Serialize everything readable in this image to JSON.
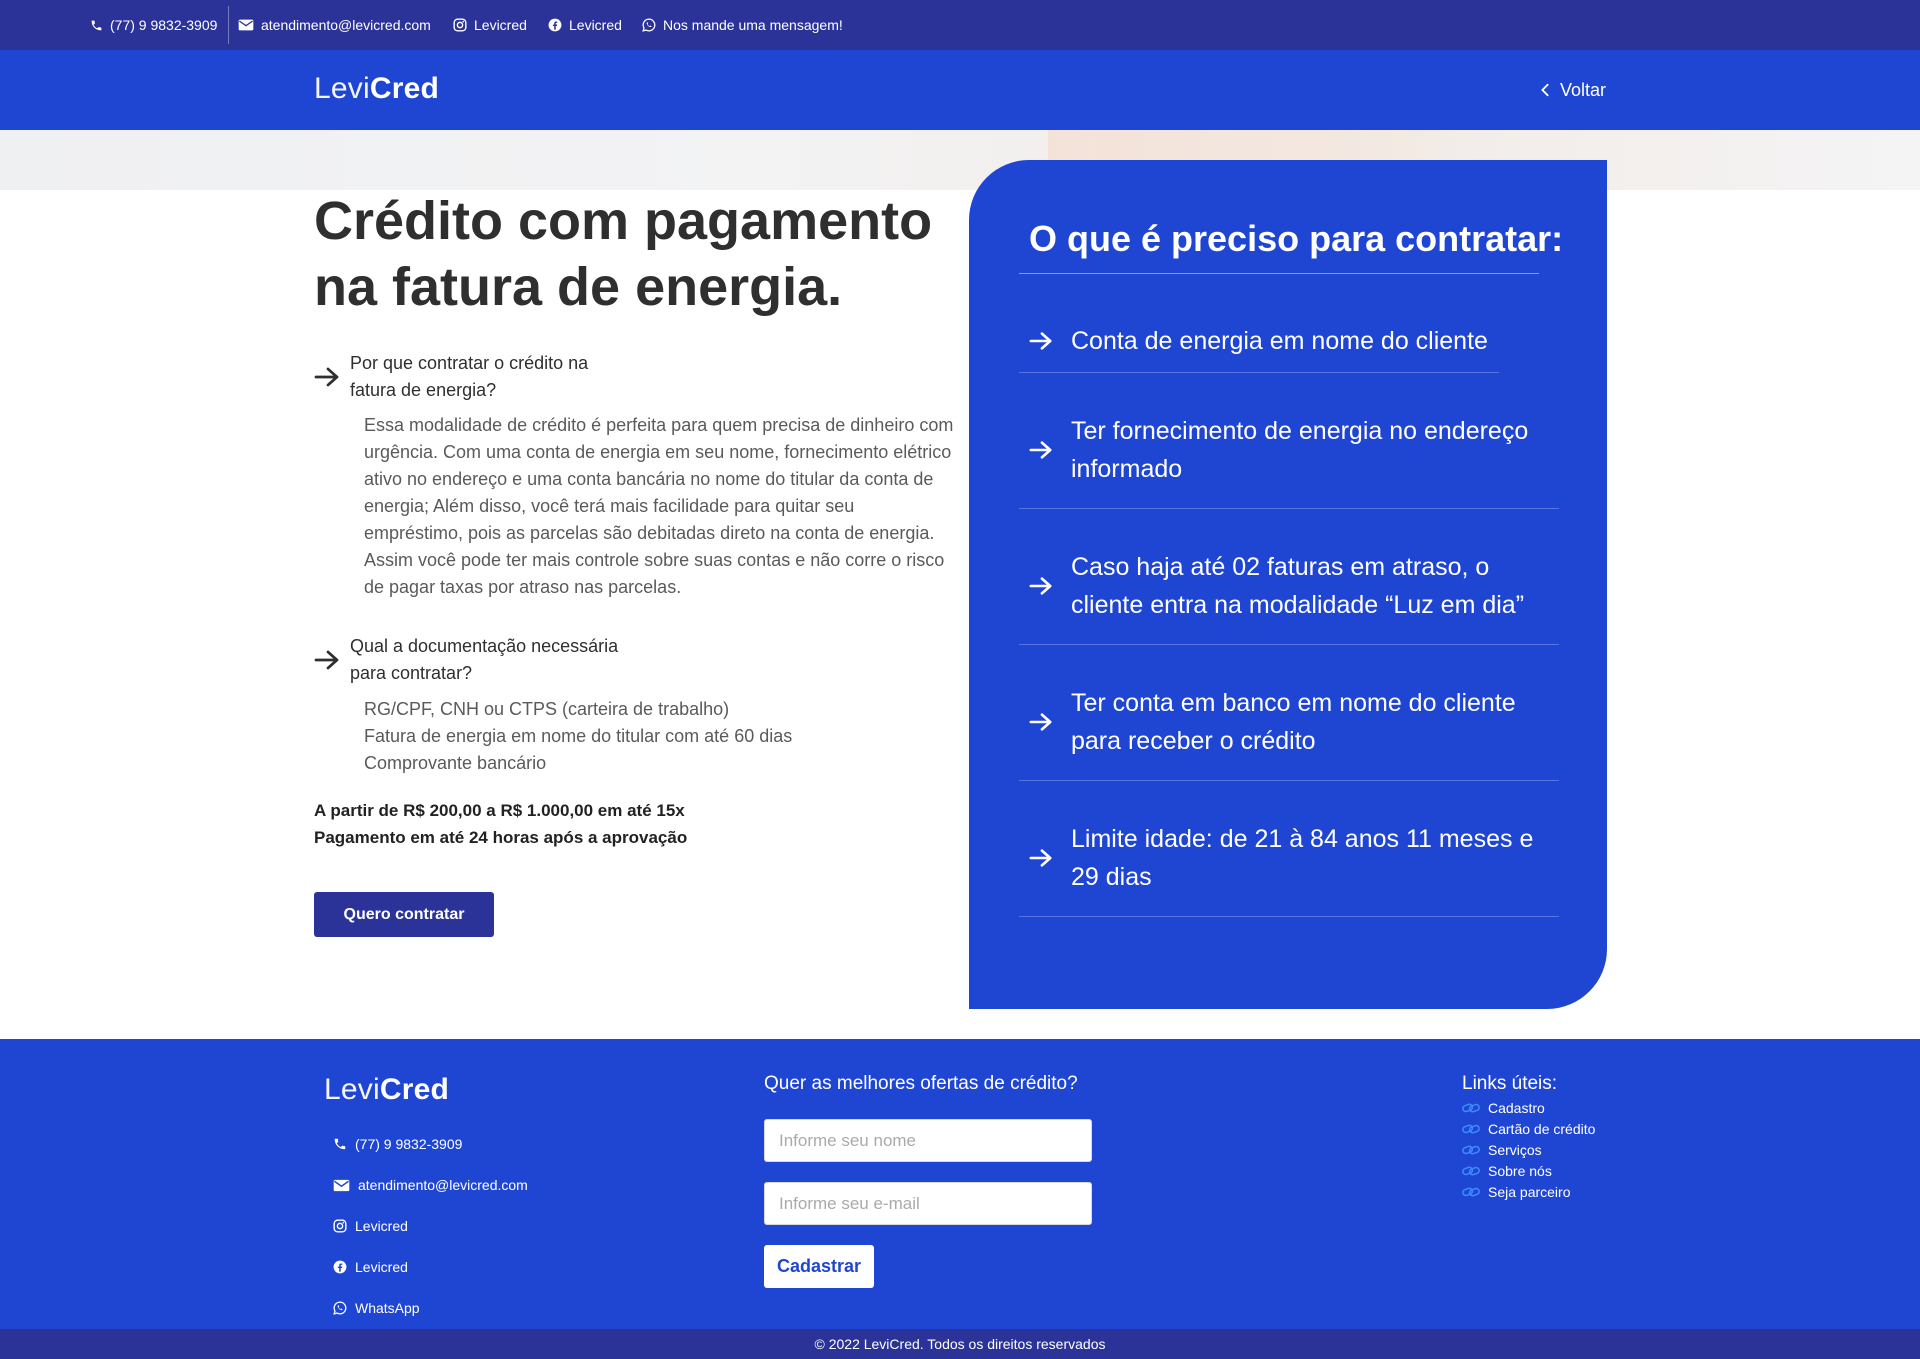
{
  "topbar": {
    "phone": "(77) 9 9832-3909",
    "email": "atendimento@levicred.com",
    "instagram": "Levicred",
    "facebook": "Levicred",
    "whatsapp": "Nos mande uma mensagem!"
  },
  "brand": {
    "part1": "Levi",
    "part2": "Cred"
  },
  "nav": {
    "back_label": "Voltar"
  },
  "hero": {
    "title": "Crédito com pagamento na fatura de energia.",
    "q1": "Por que contratar o crédito na fatura de energia?",
    "a1": "Essa modalidade de crédito é perfeita para quem precisa de dinheiro com urgência. Com uma conta de energia em seu nome, fornecimento elétrico ativo no endereço e uma conta bancária no nome do titular da conta de energia; Além disso, você terá mais facilidade para quitar seu empréstimo, pois as parcelas são debitadas direto na conta de energia. Assim você pode ter mais controle sobre suas contas e não corre o risco de pagar taxas por atraso nas parcelas.",
    "q2": "Qual a documentação necessária para contratar?",
    "docs": [
      "RG/CPF, CNH ou CTPS (carteira de trabalho)",
      "Fatura de energia em nome do titular com até 60 dias",
      "Comprovante bancário"
    ],
    "range": "A partir de R$ 200,00 a R$ 1.000,00 em até 15x",
    "payment": "Pagamento em até 24 horas após a aprovação",
    "cta": "Quero contratar"
  },
  "requirements": {
    "title": "O que é preciso para contratar:",
    "items": [
      "Conta de energia em nome do cliente",
      "Ter fornecimento de energia no endereço informado",
      "Caso haja até 02 faturas em atraso, o cliente entra na modalidade “Luz em dia”",
      "Ter conta em banco em nome do cliente para receber o crédito",
      "Limite idade: de 21 à 84 anos 11 meses e 29 dias"
    ]
  },
  "footer": {
    "contacts": {
      "phone": "(77) 9 9832-3909",
      "email": "atendimento@levicred.com",
      "instagram": "Levicred",
      "facebook": "Levicred",
      "whatsapp": "WhatsApp"
    },
    "newsletter": {
      "heading": "Quer as melhores ofertas de crédito?",
      "name_placeholder": "Informe seu nome",
      "email_placeholder": "Informe seu e-mail",
      "button": "Cadastrar"
    },
    "links": {
      "heading": "Links úteis:",
      "items": [
        "Cadastro",
        "Cartão de crédito",
        "Serviços",
        "Sobre nós",
        "Seja parceiro"
      ]
    },
    "copyright": "© 2022 LeviCred. Todos os direitos reservados"
  },
  "colors": {
    "primary_blue": "#1f46d3",
    "dark_blue": "#2b3398",
    "link_icon": "#3d8bff",
    "title_text": "#2f2f2f"
  }
}
